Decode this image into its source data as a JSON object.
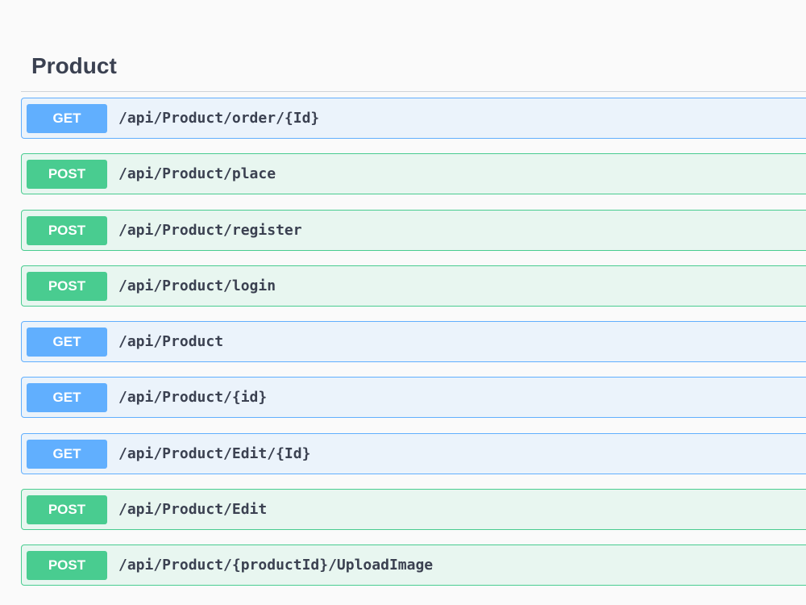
{
  "tag": {
    "title": "Product"
  },
  "colors": {
    "get": "#61affe",
    "get_bg": "#ebf3fb",
    "post": "#49cc90",
    "post_bg": "#e8f6f0",
    "text": "#3b4151"
  },
  "operations": [
    {
      "method": "GET",
      "path": "/api/Product/order/{Id}"
    },
    {
      "method": "POST",
      "path": "/api/Product/place"
    },
    {
      "method": "POST",
      "path": "/api/Product/register"
    },
    {
      "method": "POST",
      "path": "/api/Product/login"
    },
    {
      "method": "GET",
      "path": "/api/Product"
    },
    {
      "method": "GET",
      "path": "/api/Product/{id}"
    },
    {
      "method": "GET",
      "path": "/api/Product/Edit/{Id}"
    },
    {
      "method": "POST",
      "path": "/api/Product/Edit"
    },
    {
      "method": "POST",
      "path": "/api/Product/{productId}/UploadImage"
    }
  ]
}
